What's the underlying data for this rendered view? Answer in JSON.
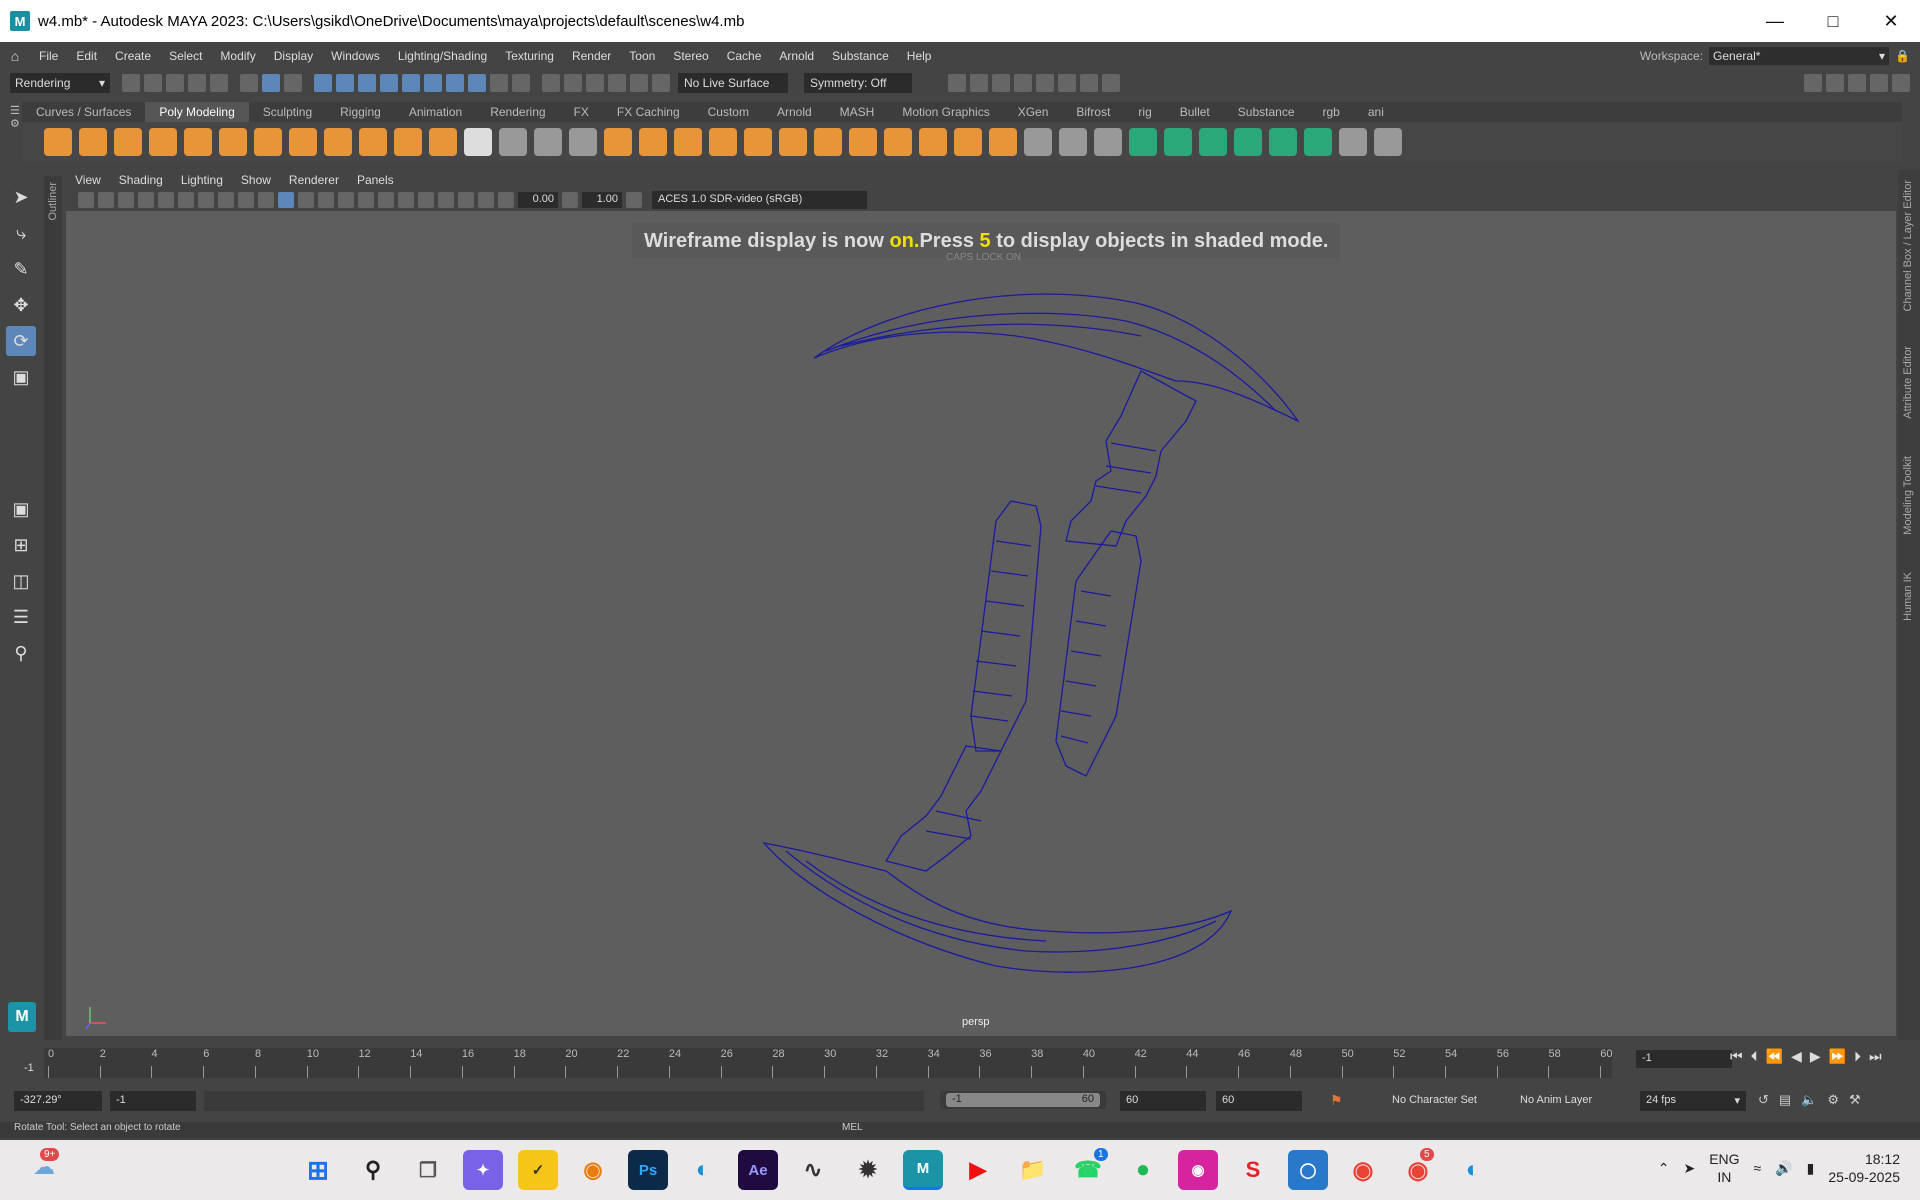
{
  "window": {
    "title": "w4.mb* - Autodesk MAYA 2023: C:\\Users\\gsikd\\OneDrive\\Documents\\maya\\projects\\default\\scenes\\w4.mb",
    "app_icon": "M"
  },
  "menubar": {
    "items": [
      "File",
      "Edit",
      "Create",
      "Select",
      "Modify",
      "Display",
      "Windows",
      "Lighting/Shading",
      "Texturing",
      "Render",
      "Toon",
      "Stereo",
      "Cache",
      "Arnold",
      "Substance",
      "Help"
    ]
  },
  "workspace": {
    "label": "Workspace:",
    "value": "General*"
  },
  "status_line": {
    "mode": "Rendering",
    "live_surface": "No Live Surface",
    "symmetry": "Symmetry: Off"
  },
  "shelf": {
    "tabs": [
      "Curves / Surfaces",
      "Poly Modeling",
      "Sculpting",
      "Rigging",
      "Animation",
      "Rendering",
      "FX",
      "FX Caching",
      "Custom",
      "Arnold",
      "MASH",
      "Motion Graphics",
      "XGen",
      "Bifrost",
      "rig",
      "Bullet",
      "Substance",
      "rgb",
      "ani"
    ],
    "active_tab": "Poly Modeling"
  },
  "side_labels": {
    "outliner": "Outliner",
    "channel_box": "Channel Box / Layer Editor",
    "attribute_editor": "Attribute Editor",
    "modeling_toolkit": "Modeling Toolkit",
    "human_ik": "Human IK"
  },
  "panel": {
    "menus": [
      "View",
      "Shading",
      "Lighting",
      "Show",
      "Renderer",
      "Panels"
    ],
    "exposure": "0.00",
    "gamma": "1.00",
    "color_space": "ACES 1.0 SDR-video (sRGB)"
  },
  "viewport": {
    "hud_part1": "Wireframe display is now ",
    "hud_on": "on.",
    "hud_part2": "Press ",
    "hud_key": "5",
    "hud_part3": " to display objects in shaded mode.",
    "caps_lock": "CAPS LOCK ON",
    "camera": "persp",
    "wire_color": "#1a1aa0"
  },
  "time_slider": {
    "ticks": [
      "0",
      "2",
      "4",
      "6",
      "8",
      "10",
      "12",
      "14",
      "16",
      "18",
      "20",
      "22",
      "24",
      "26",
      "28",
      "30",
      "32",
      "34",
      "36",
      "38",
      "40",
      "42",
      "44",
      "46",
      "48",
      "50",
      "52",
      "54",
      "56",
      "58",
      "60"
    ],
    "current_marker": "-1",
    "current_frame": "-1"
  },
  "range": {
    "rotate_value": "-327.29°",
    "start": "-1",
    "slider_start": "-1",
    "slider_end": "60",
    "end": "60",
    "anim_end": "60",
    "character_set": "No Character Set",
    "anim_layer": "No Anim Layer",
    "fps": "24 fps"
  },
  "help_line": {
    "text": "Rotate Tool: Select an object to rotate",
    "mel": "MEL"
  },
  "taskbar": {
    "weather_badge": "9+",
    "whatsapp_badge": "1",
    "chrome_badge": "5",
    "lang1": "ENG",
    "lang2": "IN",
    "time": "18:12",
    "date": "25-09-2025"
  }
}
